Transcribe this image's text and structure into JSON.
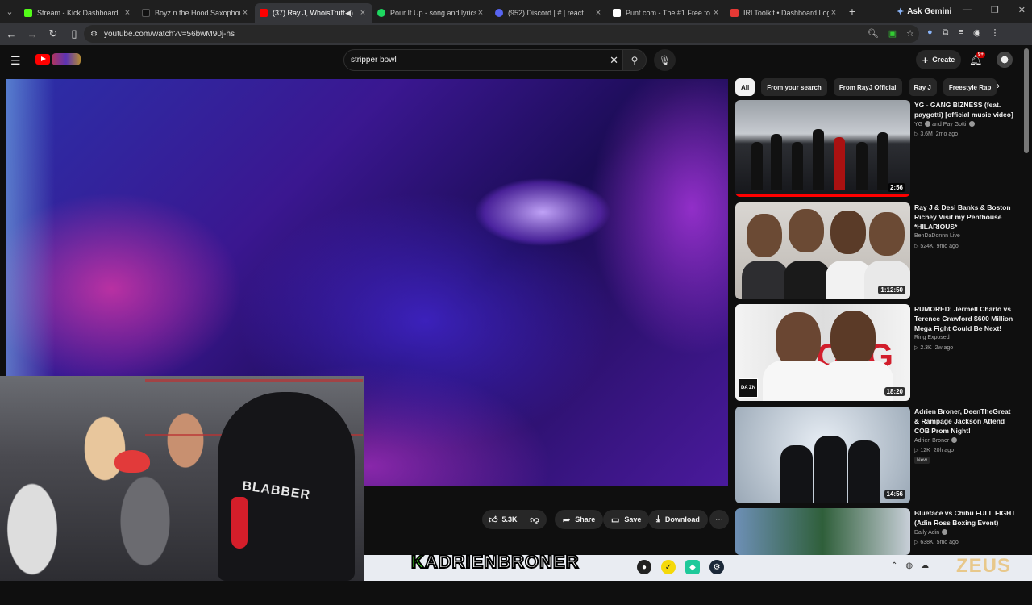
{
  "browser": {
    "tabs": [
      {
        "label": "Stream - Kick Dashboard",
        "fav": "#53fc18",
        "active": false
      },
      {
        "label": "Boyz n the Hood Saxophone",
        "fav": "#111111",
        "active": false
      },
      {
        "label": "(37) Ray J, WhoisTruth",
        "fav": "#ff0000",
        "active": true
      },
      {
        "label": "Pour It Up - song and lyrics",
        "fav": "#1ed760",
        "active": false
      },
      {
        "label": "(952) Discord | # | react",
        "fav": "#5865f2",
        "active": false
      },
      {
        "label": "Punt.com - The #1 Free to",
        "fav": "#ffffff",
        "active": false
      },
      {
        "label": "IRLToolkit • Dashboard Log",
        "fav": "#e53935",
        "active": false
      }
    ],
    "gemini_label": "Ask Gemini",
    "url": "youtube.com/watch?v=56bwM90j-hs"
  },
  "youtube": {
    "search_value": "stripper bowl",
    "create_label": "Create",
    "notif_badge": "9+"
  },
  "actions": {
    "likes": "5.3K",
    "share": "Share",
    "save": "Save",
    "download": "Download"
  },
  "chips": [
    "All",
    "From your search",
    "From RayJ Official",
    "Ray J",
    "Freestyle Rap"
  ],
  "recommendations": [
    {
      "title": "YG - GANG BIZNESS (feat. paygotti) [official music video]",
      "channel": "YG",
      "channel_extra": "and Pay Gotti",
      "views": "3.6M",
      "age": "2mo ago",
      "duration": "2:56",
      "watched": true
    },
    {
      "title": "Ray J & Desi Banks & Boston Richey Visit my Penthouse *HILARIOUS*",
      "channel": "BenDaDonnn Live",
      "views": "524K",
      "age": "9mo ago",
      "duration": "1:12:50"
    },
    {
      "title": "RUMORED: Jermell Charlo vs Terence Crawford $600 Million Mega Fight Could Be Next!",
      "channel": "Ring Exposed",
      "views": "2.3K",
      "age": "2w ago",
      "duration": "18:20",
      "thumb_text": "DOUG",
      "thumb_logo": "DA ZN"
    },
    {
      "title": "Adrien Broner, DeenTheGreat & Rampage Jackson Attend COB Prom Night!",
      "channel": "Adrien Broner",
      "views": "12K",
      "age": "20h ago",
      "duration": "14:56",
      "badge": "New"
    },
    {
      "title": "Blueface vs Chibu FULL FIGHT (Adin Ross Boxing Event)",
      "channel": "Daily Adin",
      "views": "638K",
      "age": "5mo ago"
    }
  ],
  "overlay": {
    "name_k": "K",
    "name_rest": "ADRIENBRONER",
    "hoodie_text": "BLABBER",
    "watermark": "ZEUS"
  }
}
